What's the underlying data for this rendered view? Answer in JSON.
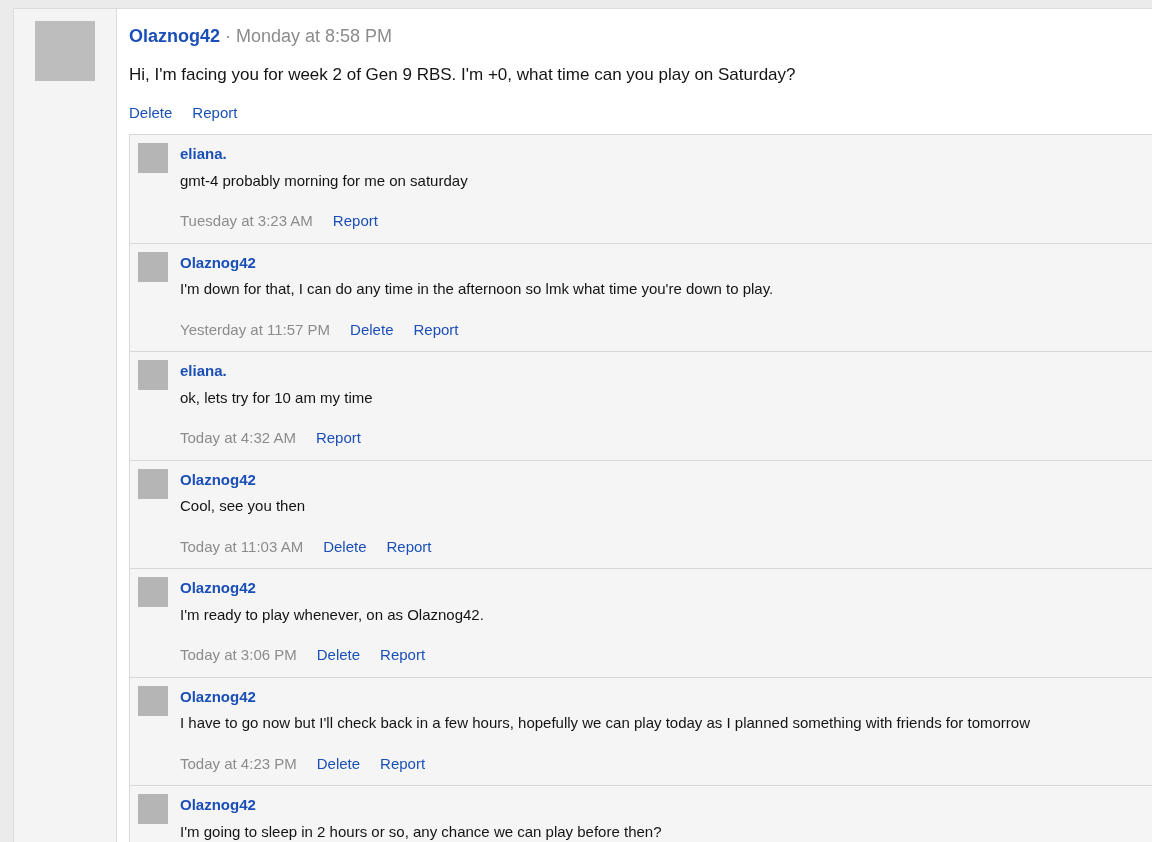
{
  "post": {
    "author": "Olaznog42",
    "separator": "·",
    "time": "Monday at 8:58 PM",
    "text": "Hi, I'm facing you for week 2 of Gen 9 RBS. I'm +0, what time can you play on Saturday?",
    "actions": [
      "Delete",
      "Report"
    ]
  },
  "comments": [
    {
      "author": "eliana.",
      "text": "gmt-4 probably morning for me on saturday",
      "time": "Tuesday at 3:23 AM",
      "actions": [
        "Report"
      ]
    },
    {
      "author": "Olaznog42",
      "text": "I'm down for that, I can do any time in the afternoon so lmk what time you're down to play.",
      "time": "Yesterday at 11:57 PM",
      "actions": [
        "Delete",
        "Report"
      ]
    },
    {
      "author": "eliana.",
      "text": "ok, lets try for 10 am my time",
      "time": "Today at 4:32 AM",
      "actions": [
        "Report"
      ]
    },
    {
      "author": "Olaznog42",
      "text": "Cool, see you then",
      "time": "Today at 11:03 AM",
      "actions": [
        "Delete",
        "Report"
      ]
    },
    {
      "author": "Olaznog42",
      "text": "I'm ready to play whenever, on as Olaznog42.",
      "time": "Today at 3:06 PM",
      "actions": [
        "Delete",
        "Report"
      ]
    },
    {
      "author": "Olaznog42",
      "text": "I have to go now but I'll check back in a few hours, hopefully we can play today as I planned something with friends for tomorrow",
      "time": "Today at 4:23 PM",
      "actions": [
        "Delete",
        "Report"
      ]
    },
    {
      "author": "Olaznog42",
      "text": "I'm going to sleep in 2 hours or so, any chance we can play before then?"
    }
  ]
}
